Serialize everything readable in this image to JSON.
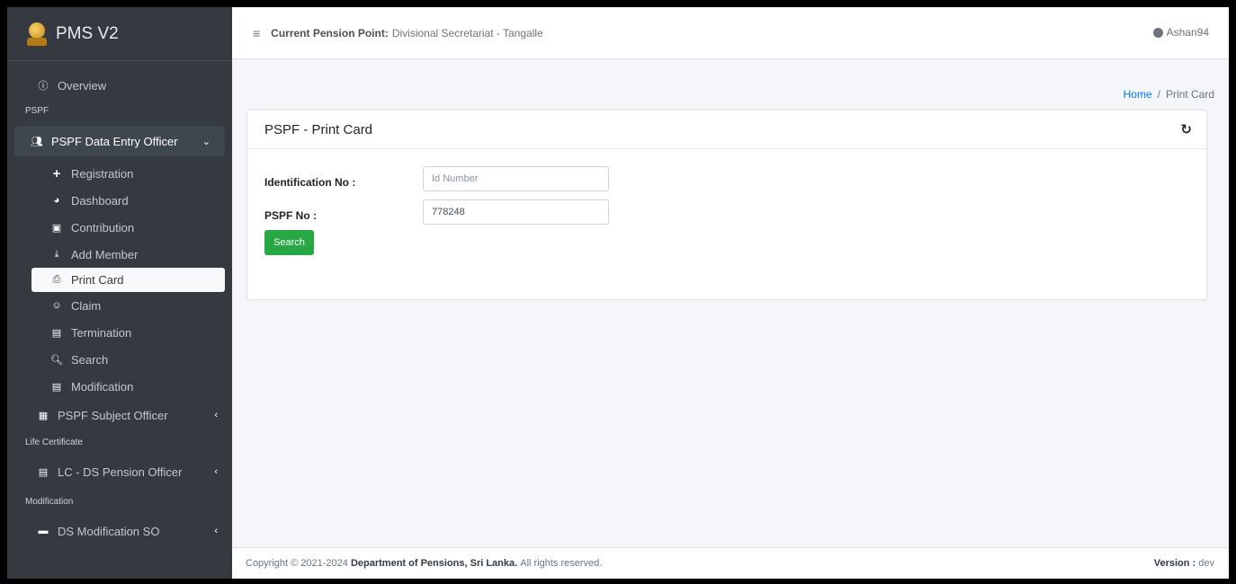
{
  "brand": {
    "title": "PMS V2",
    "logo": "sri-lanka-emblem"
  },
  "sidebar": {
    "overview": {
      "label": "Overview",
      "icon": "info-circle-icon"
    },
    "section_pspf": "PSPF",
    "pspf_group": {
      "label": "PSPF Data Entry Officer",
      "icon": "users-icon"
    },
    "items": [
      {
        "label": "Registration",
        "icon": "plus-icon"
      },
      {
        "label": "Dashboard",
        "icon": "dashboard-icon"
      },
      {
        "label": "Contribution",
        "icon": "money-bill-icon"
      },
      {
        "label": "Add Member",
        "icon": "download-icon"
      },
      {
        "label": "Print Card",
        "icon": "print-icon"
      },
      {
        "label": "Claim",
        "icon": "user-cog-icon"
      },
      {
        "label": "Termination",
        "icon": "file-icon"
      },
      {
        "label": "Search",
        "icon": "search-icon"
      },
      {
        "label": "Modification",
        "icon": "file-icon"
      }
    ],
    "subject_officer": {
      "label": "PSPF Subject Officer",
      "icon": "archive-icon"
    },
    "section_life": "Life Certificate",
    "lc_officer": {
      "label": "LC - DS Pension Officer",
      "icon": "file-icon"
    },
    "section_mod": "Modification",
    "ds_mod": {
      "label": "DS Modification SO",
      "icon": "folder-icon"
    }
  },
  "topbar": {
    "point_label": "Current Pension Point:",
    "point_value": "Divisional Secretariat - Tangalle",
    "user": "Ashan94"
  },
  "breadcrumb": {
    "home": "Home",
    "separator": "/",
    "current": "Print Card"
  },
  "card": {
    "title": "PSPF - Print Card",
    "id_label": "Identification No :",
    "id_placeholder": "Id Number",
    "id_value": "",
    "pspf_label": "PSPF No :",
    "pspf_value": "778248",
    "search_button": "Search"
  },
  "footer": {
    "copyright": "Copyright © 2021-2024",
    "org": "Department of Pensions, Sri Lanka.",
    "rights": "All rights reserved.",
    "version_label": "Version :",
    "version_value": "dev"
  },
  "colors": {
    "sidebar": "#343a40",
    "accent": "#007bff",
    "success": "#28a745"
  }
}
